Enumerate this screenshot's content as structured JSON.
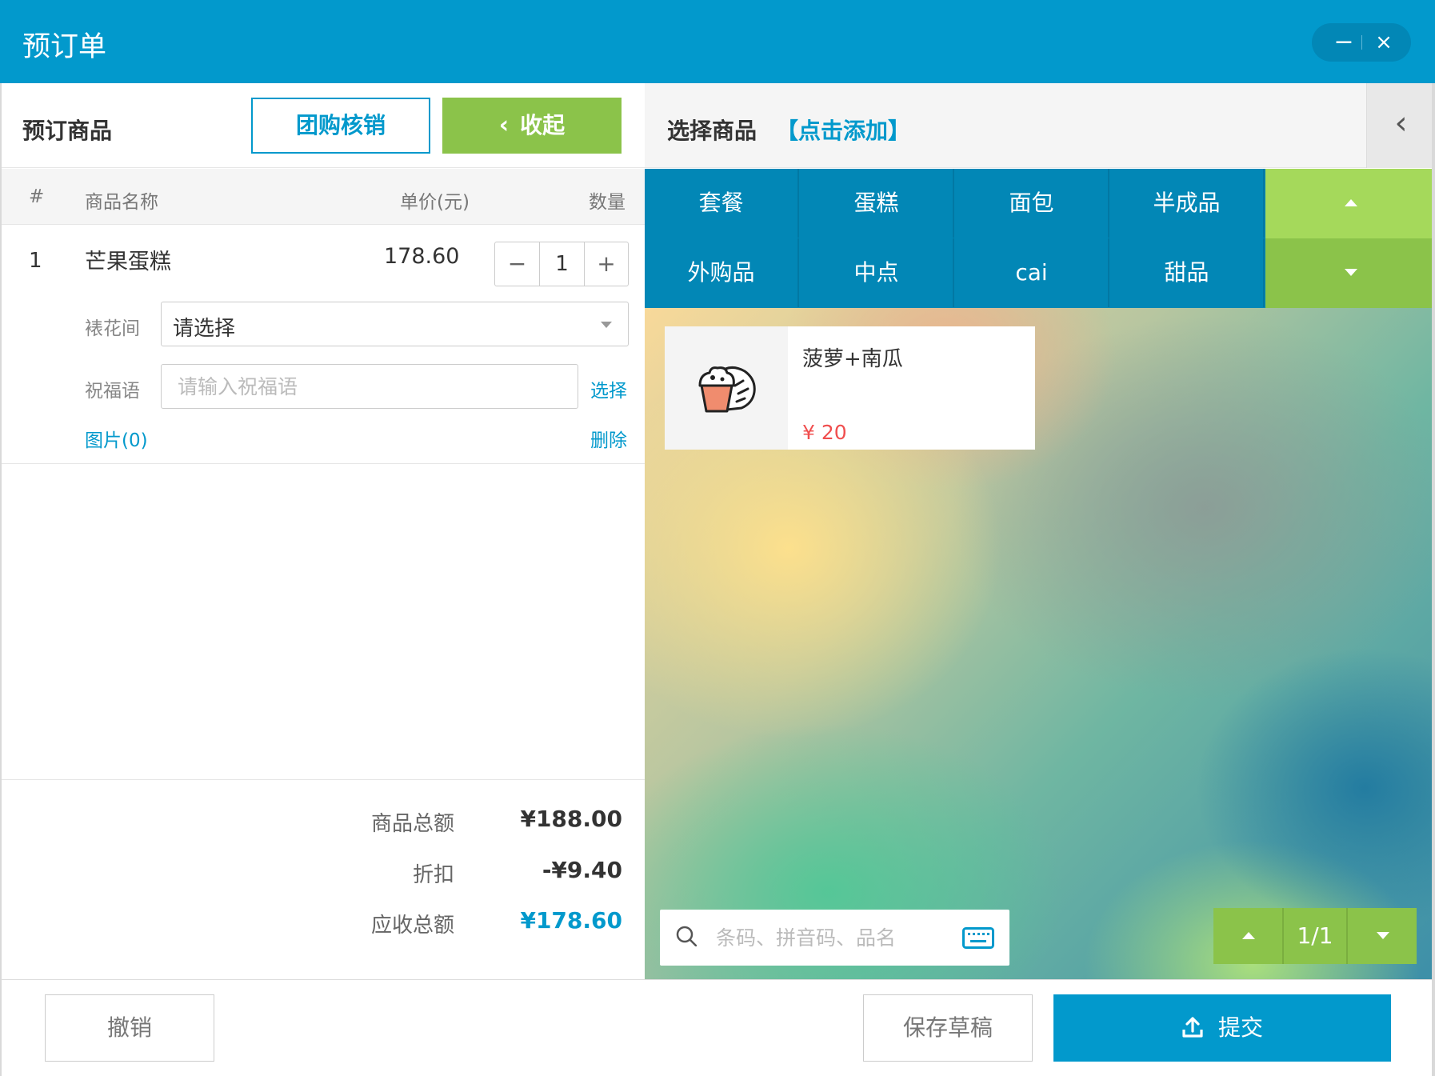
{
  "window": {
    "title": "预订单",
    "minimize_label": "−",
    "close_label": "×"
  },
  "left": {
    "header_label": "预订商品",
    "group_buy_button": "团购核销",
    "fold_button": "收起",
    "table_headers": {
      "index": "#",
      "name": "商品名称",
      "price": "单价(元)",
      "qty": "数量"
    },
    "items": [
      {
        "index": "1",
        "name": "芒果蛋糕",
        "price": "178.60",
        "qty": "1",
        "minus": "−",
        "plus": "+",
        "decoration_label": "裱花间",
        "decoration_value": "请选择",
        "blessing_label": "祝福语",
        "blessing_placeholder": "请输入祝福语",
        "blessing_value": "",
        "select_link": "选择",
        "images_link": "图片(0)",
        "delete_link": "删除"
      }
    ],
    "summary": {
      "total_label": "商品总额",
      "total_value": "¥188.00",
      "discount_label": "折扣",
      "discount_value": "-¥9.40",
      "receivable_label": "应收总额",
      "receivable_value": "¥178.60"
    }
  },
  "right": {
    "header_label": "选择商品",
    "add_link": "【点击添加】",
    "collapse_icon": "‹",
    "categories": [
      "套餐",
      "蛋糕",
      "面包",
      "半成品",
      "外购品",
      "中点",
      "cai",
      "甜品"
    ],
    "products": [
      {
        "name": "菠萝+南瓜",
        "price": "¥ 20",
        "icon": "cake-bread-icon"
      }
    ],
    "search": {
      "placeholder": "条码、拼音码、品名",
      "value": ""
    },
    "pager": {
      "text": "1/1"
    }
  },
  "footer": {
    "cancel": "撤销",
    "save_draft": "保存草稿",
    "submit": "提交"
  },
  "colors": {
    "primary": "#0299cc",
    "green": "#8bc34a",
    "price_red": "#f04e4e"
  }
}
